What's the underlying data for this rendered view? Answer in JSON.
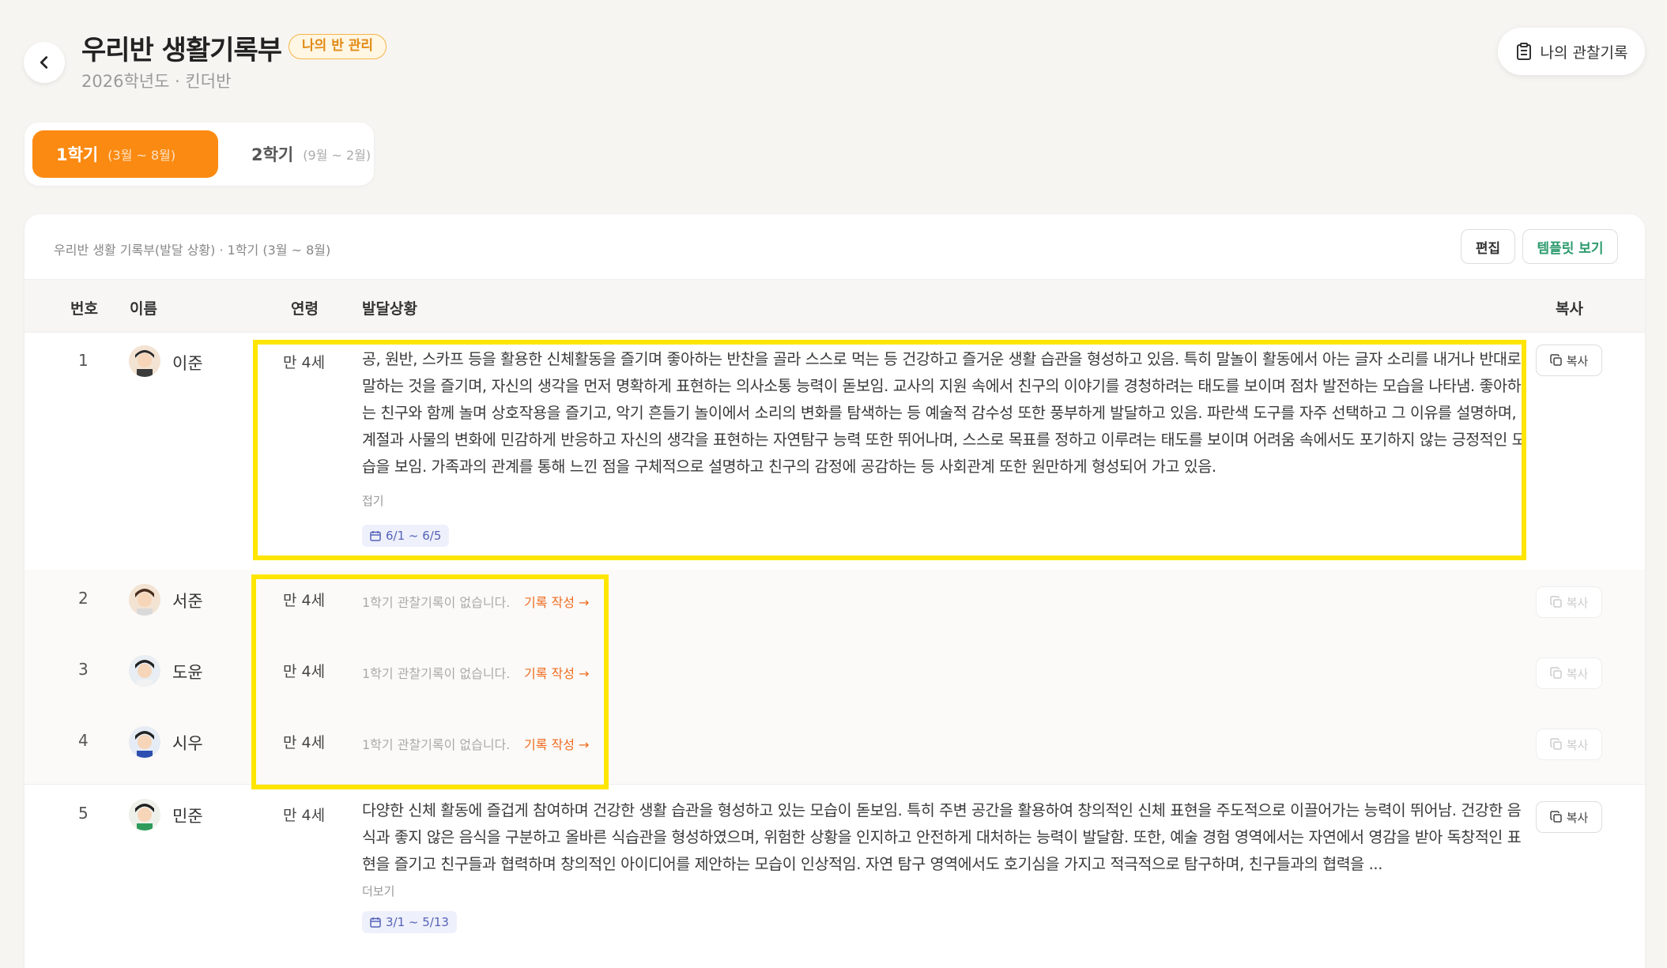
{
  "header": {
    "title": "우리반 생활기록부",
    "badge": "나의 반 관리",
    "subtitle": "2026학년도 · 킨더반",
    "observe_button": "나의 관찰기록"
  },
  "tabs": [
    {
      "label": "1학기",
      "range": "(3월 ~ 8월)",
      "active": true
    },
    {
      "label": "2학기",
      "range": "(9월 ~ 2월)",
      "active": false
    }
  ],
  "card": {
    "caption": "우리반 생활 기록부(발달 상황) · 1학기 (3월 ~ 8월)",
    "edit_button": "편집",
    "template_button": "템플릿 보기"
  },
  "table": {
    "headers": {
      "no": "번호",
      "name": "이름",
      "age": "연령",
      "status": "발달상황",
      "copy": "복사"
    },
    "rows": [
      {
        "no": "1",
        "name": "이준",
        "age": "만 4세",
        "text": "공, 원반, 스카프 등을 활용한 신체활동을 즐기며 좋아하는 반찬을 골라 스스로 먹는 등 건강하고 즐거운 생활 습관을 형성하고 있음. 특히 말놀이 활동에서 아는 글자 소리를 내거나 반대로 말하는 것을 즐기며, 자신의 생각을 먼저 명확하게 표현하는 의사소통 능력이 돋보임. 교사의 지원 속에서 친구의 이야기를 경청하려는 태도를 보이며 점차 발전하는 모습을 나타냄. 좋아하는 친구와 함께 놀며 상호작용을 즐기고, 악기 흔들기 놀이에서 소리의 변화를 탐색하는 등 예술적 감수성 또한 풍부하게 발달하고 있음. 파란색 도구를 자주 선택하고 그 이유를 설명하며, 계절과 사물의 변화에 민감하게 반응하고 자신의 생각을 표현하는 자연탐구 능력 또한 뛰어나며, 스스로 목표를 정하고 이루려는 태도를 보이며 어려움 속에서도 포기하지 않는 긍정적인 모습을 보임. 가족과의 관계를 통해 느낀 점을 구체적으로 설명하고 친구의 감정에 공감하는 등 사회관계 또한 원만하게 형성되어 가고 있음.",
        "toggle": "접기",
        "date": "6/1 ~ 6/5",
        "copy": "복사"
      },
      {
        "no": "2",
        "name": "서준",
        "age": "만 4세",
        "empty": "1학기 관찰기록이 없습니다.",
        "write": "기록 작성 →",
        "copy": "복사"
      },
      {
        "no": "3",
        "name": "도윤",
        "age": "만 4세",
        "empty": "1학기 관찰기록이 없습니다.",
        "write": "기록 작성 →",
        "copy": "복사"
      },
      {
        "no": "4",
        "name": "시우",
        "age": "만 4세",
        "empty": "1학기 관찰기록이 없습니다.",
        "write": "기록 작성 →",
        "copy": "복사"
      },
      {
        "no": "5",
        "name": "민준",
        "age": "만 4세",
        "text": "다양한 신체 활동에 즐겁게 참여하며 건강한 생활 습관을 형성하고 있는 모습이 돋보임. 특히 주변 공간을 활용하여 창의적인 신체 표현을 주도적으로 이끌어가는 능력이 뛰어남. 건강한 음식과 좋지 않은 음식을 구분하고 올바른 식습관을 형성하였으며, 위험한 상황을 인지하고 안전하게 대처하는 능력이 발달함. 또한, 예술 경험 영역에서는 자연에서 영감을 받아 독창적인 표현을 즐기고 친구들과 협력하며 창의적인 아이디어를 제안하는 모습이 인상적임. 자연 탐구 영역에서도 호기심을 가지고 적극적으로 탐구하며, 친구들과의 협력을 ...",
        "toggle": "더보기",
        "date": "3/1 ~ 5/13",
        "copy": "복사"
      }
    ]
  },
  "colors": {
    "accent": "#fb8a12",
    "highlight": "#ffe500",
    "template_green": "#2e9b6e",
    "write_link": "#ef6b1e"
  },
  "icons": [
    "chevron-left-icon",
    "clipboard-icon",
    "calendar-icon",
    "copy-icon"
  ]
}
